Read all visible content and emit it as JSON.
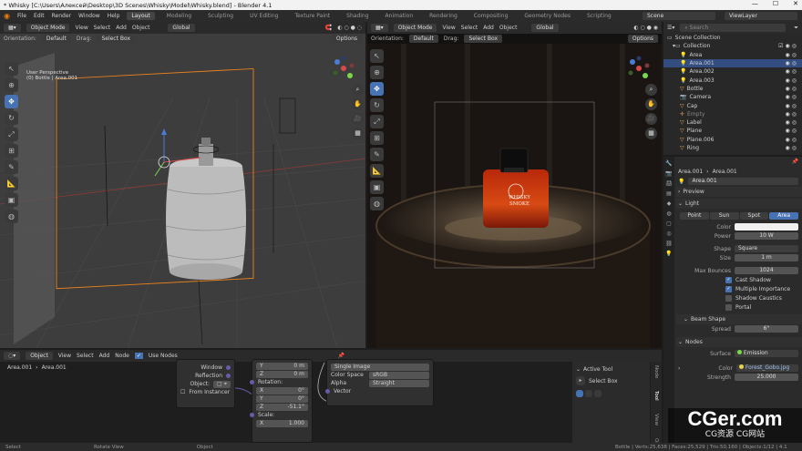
{
  "window": {
    "title": "* Whisky [C:\\Users\\Алексей\\Desktop\\3D Scenes\\Whisky\\Model\\Whisky.blend] - Blender 4.1",
    "minimize": "—",
    "maximize": "☐",
    "close": "✕"
  },
  "menu": [
    "File",
    "Edit",
    "Render",
    "Window",
    "Help"
  ],
  "workspaces": [
    "Layout",
    "Modeling",
    "Sculpting",
    "UV Editing",
    "Texture Paint",
    "Shading",
    "Animation",
    "Rendering",
    "Compositing",
    "Geometry Nodes",
    "Scripting"
  ],
  "active_workspace": "Layout",
  "scene": {
    "label": "Scene",
    "view_layer": "ViewLayer"
  },
  "viewport_left": {
    "mode": "Object Mode",
    "menus": [
      "View",
      "Select",
      "Add",
      "Object"
    ],
    "transform": "Global",
    "orientation_label": "Orientation:",
    "orientation_value": "Default",
    "drag_label": "Drag:",
    "drag_value": "Select Box",
    "options": "Options",
    "info_line1": "User Perspective",
    "info_line2": "(0) Bottle | Area.001"
  },
  "viewport_right": {
    "mode": "Object Mode",
    "menus": [
      "View",
      "Select",
      "Add",
      "Object"
    ],
    "transform": "Global",
    "orientation_label": "Orientation:",
    "orientation_value": "Default",
    "drag_label": "Drag:",
    "drag_value": "Select Box",
    "options": "Options",
    "label_line1": "WHISKY",
    "label_line2": "SMOKE"
  },
  "outliner": {
    "root": "Scene Collection",
    "collection": "Collection",
    "items": [
      "Area",
      "Area.001",
      "Area.002",
      "Area.003",
      "Bottle",
      "Camera",
      "Cap",
      "Empty",
      "Label",
      "Plane",
      "Plane.006",
      "Ring"
    ],
    "active_item": "Area.001",
    "search_placeholder": "Search"
  },
  "properties": {
    "breadcrumb_a": "Area.001",
    "breadcrumb_b": "Area.001",
    "datablock": "Area.001",
    "preview": "Preview",
    "light_panel": "Light",
    "light_types": [
      "Point",
      "Sun",
      "Spot",
      "Area"
    ],
    "active_light_type": "Area",
    "color_label": "Color",
    "color_value": "#f0f0f0",
    "power_label": "Power",
    "power_value": "10 W",
    "shape_label": "Shape",
    "shape_value": "Square",
    "size_label": "Size",
    "size_value": "1 m",
    "bounces_label": "Max Bounces",
    "bounces_value": "1024",
    "checks": [
      {
        "label": "Cast Shadow",
        "checked": true
      },
      {
        "label": "Multiple Importance",
        "checked": true
      },
      {
        "label": "Shadow Caustics",
        "checked": false
      },
      {
        "label": "Portal",
        "checked": false
      }
    ],
    "beam_shape": "Beam Shape",
    "spread_label": "Spread",
    "spread_value": "6°",
    "nodes_panel": "Nodes",
    "surface_label": "Surface",
    "surface_value": "Emission",
    "ncolor_label": "Color",
    "ncolor_value": "Forest_Gobo.jpg",
    "strength_label": "Strength",
    "strength_value": "25.000"
  },
  "node_editor": {
    "editor_type": "Object",
    "menus": [
      "View",
      "Select",
      "Add",
      "Node"
    ],
    "use_nodes": "Use Nodes",
    "breadcrumb_a": "Area.001",
    "breadcrumb_b": "Area.001",
    "coord_node": {
      "outputs": [
        "Window",
        "Reflection"
      ],
      "object_label": "Object:",
      "from_instancer": "From Instancer"
    },
    "mapping_node": {
      "loc": [
        {
          "axis": "Y",
          "value": "0 m"
        },
        {
          "axis": "Z",
          "value": "0 m"
        }
      ],
      "rotation_label": "Rotation:",
      "rot": [
        {
          "axis": "X",
          "value": "0°"
        },
        {
          "axis": "Y",
          "value": "0°"
        },
        {
          "axis": "Z",
          "value": "-51.1°"
        }
      ],
      "scale_label": "Scale:",
      "scale": [
        {
          "axis": "X",
          "value": "1.000"
        }
      ]
    },
    "image_node": {
      "projection": "Single Image",
      "cs_label": "Color Space",
      "cs_value": "sRGB",
      "alpha_label": "Alpha",
      "alpha_value": "Straight",
      "vector": "Vector"
    },
    "active_tool": {
      "title": "Active Tool",
      "tool": "Select Box"
    },
    "tabs": [
      "Node",
      "Tool",
      "View",
      "Options"
    ]
  },
  "status": {
    "select": "Select",
    "rotate": "Rotate View",
    "object": "Object",
    "stats": "Bottle | Verts:25,638 | Faces:25,529 | Tris:50,160 | Objects:1/12 | 4.1"
  },
  "watermark": {
    "big": "CGer.com",
    "small": "CG资源 CG网站"
  }
}
